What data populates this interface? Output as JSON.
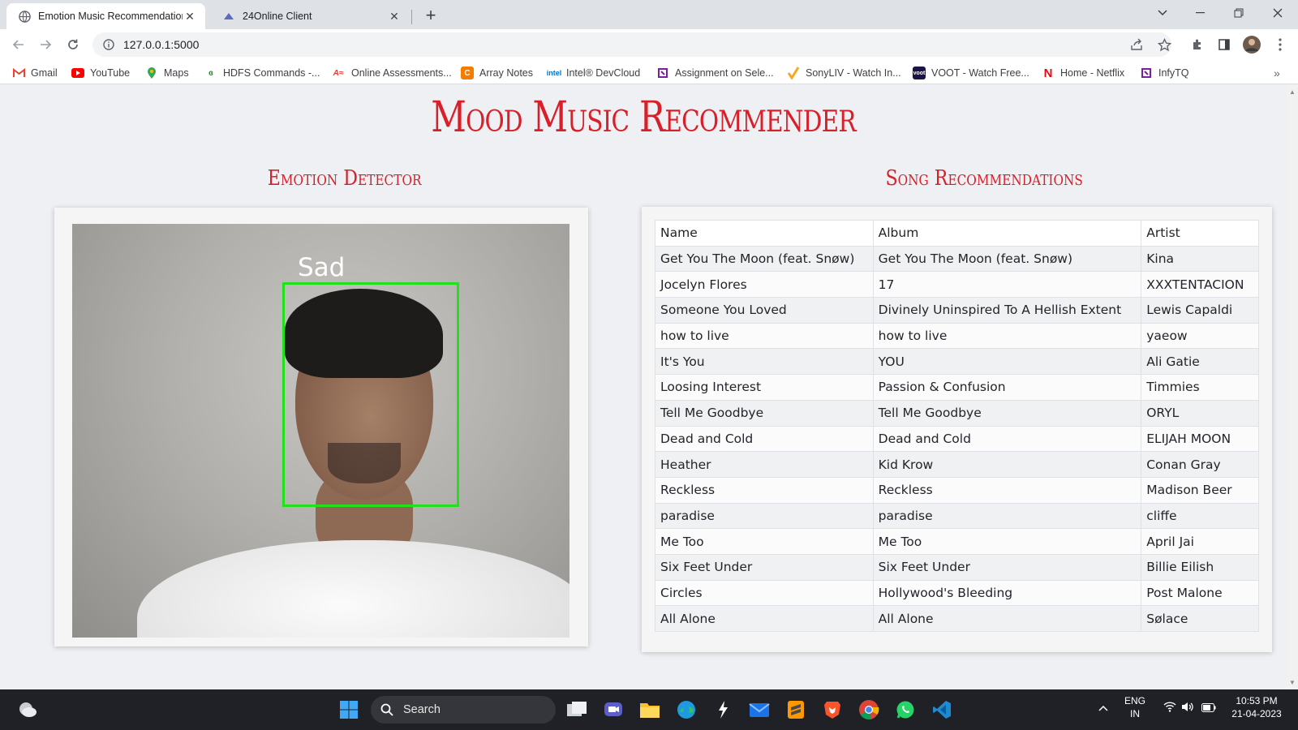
{
  "browser": {
    "tabs": [
      {
        "title": "Emotion Music Recommendation",
        "active": true
      },
      {
        "title": "24Online Client",
        "active": false
      }
    ],
    "address": "127.0.0.1:5000",
    "bookmarks": [
      {
        "label": "Gmail",
        "icon": "gmail-icon",
        "color": "#ea4335"
      },
      {
        "label": "YouTube",
        "icon": "youtube-icon",
        "color": "#ff0000"
      },
      {
        "label": "Maps",
        "icon": "maps-icon",
        "color": "#34a853"
      },
      {
        "label": "HDFS Commands -...",
        "icon": "hdfs-icon",
        "color": "#2e7d32"
      },
      {
        "label": "Online Assessments...",
        "icon": "assessments-icon",
        "color": "#e53935"
      },
      {
        "label": "Array Notes",
        "icon": "array-notes-icon",
        "color": "#f57c00"
      },
      {
        "label": "Intel® DevCloud",
        "icon": "intel-icon",
        "color": "#0071c5"
      },
      {
        "label": "Assignment on Sele...",
        "icon": "assignment-icon",
        "color": "#7b1fa2"
      },
      {
        "label": "SonyLIV - Watch In...",
        "icon": "sonyliv-icon",
        "color": "#f9a825"
      },
      {
        "label": "VOOT - Watch Free...",
        "icon": "voot-icon",
        "color": "#1a1446"
      },
      {
        "label": "Home - Netflix",
        "icon": "netflix-icon",
        "color": "#e50914"
      },
      {
        "label": "InfyTQ",
        "icon": "infytq-icon",
        "color": "#7b1fa2"
      }
    ]
  },
  "page": {
    "title": "Mood Music Recommender",
    "left_section_title": "Emotion Detector",
    "right_section_title": "Song Recommendations",
    "detected_emotion": "Sad",
    "table": {
      "headers": [
        "Name",
        "Album",
        "Artist"
      ],
      "rows": [
        [
          "Get You The Moon (feat. Snøw)",
          "Get You The Moon (feat. Snøw)",
          "Kina"
        ],
        [
          "Jocelyn Flores",
          "17",
          "XXXTENTACION"
        ],
        [
          "Someone You Loved",
          "Divinely Uninspired To A Hellish Extent",
          "Lewis Capaldi"
        ],
        [
          "how to live",
          "how to live",
          "yaeow"
        ],
        [
          "It's You",
          "YOU",
          "Ali Gatie"
        ],
        [
          "Loosing Interest",
          "Passion & Confusion",
          "Timmies"
        ],
        [
          "Tell Me Goodbye",
          "Tell Me Goodbye",
          "ORYL"
        ],
        [
          "Dead and Cold",
          "Dead and Cold",
          "ELIJAH MOON"
        ],
        [
          "Heather",
          "Kid Krow",
          "Conan Gray"
        ],
        [
          "Reckless",
          "Reckless",
          "Madison Beer"
        ],
        [
          "paradise",
          "paradise",
          "cliffe"
        ],
        [
          "Me Too",
          "Me Too",
          "April Jai"
        ],
        [
          "Six Feet Under",
          "Six Feet Under",
          "Billie Eilish"
        ],
        [
          "Circles",
          "Hollywood's Bleeding",
          "Post Malone"
        ],
        [
          "All Alone",
          "All Alone",
          "Sølace"
        ]
      ]
    },
    "colors": {
      "accent": "#d8202a",
      "detection_box": "#22e01c"
    }
  },
  "taskbar": {
    "search_label": "Search",
    "lang": "ENG",
    "region": "IN",
    "time": "10:53 PM",
    "date": "21-04-2023"
  }
}
